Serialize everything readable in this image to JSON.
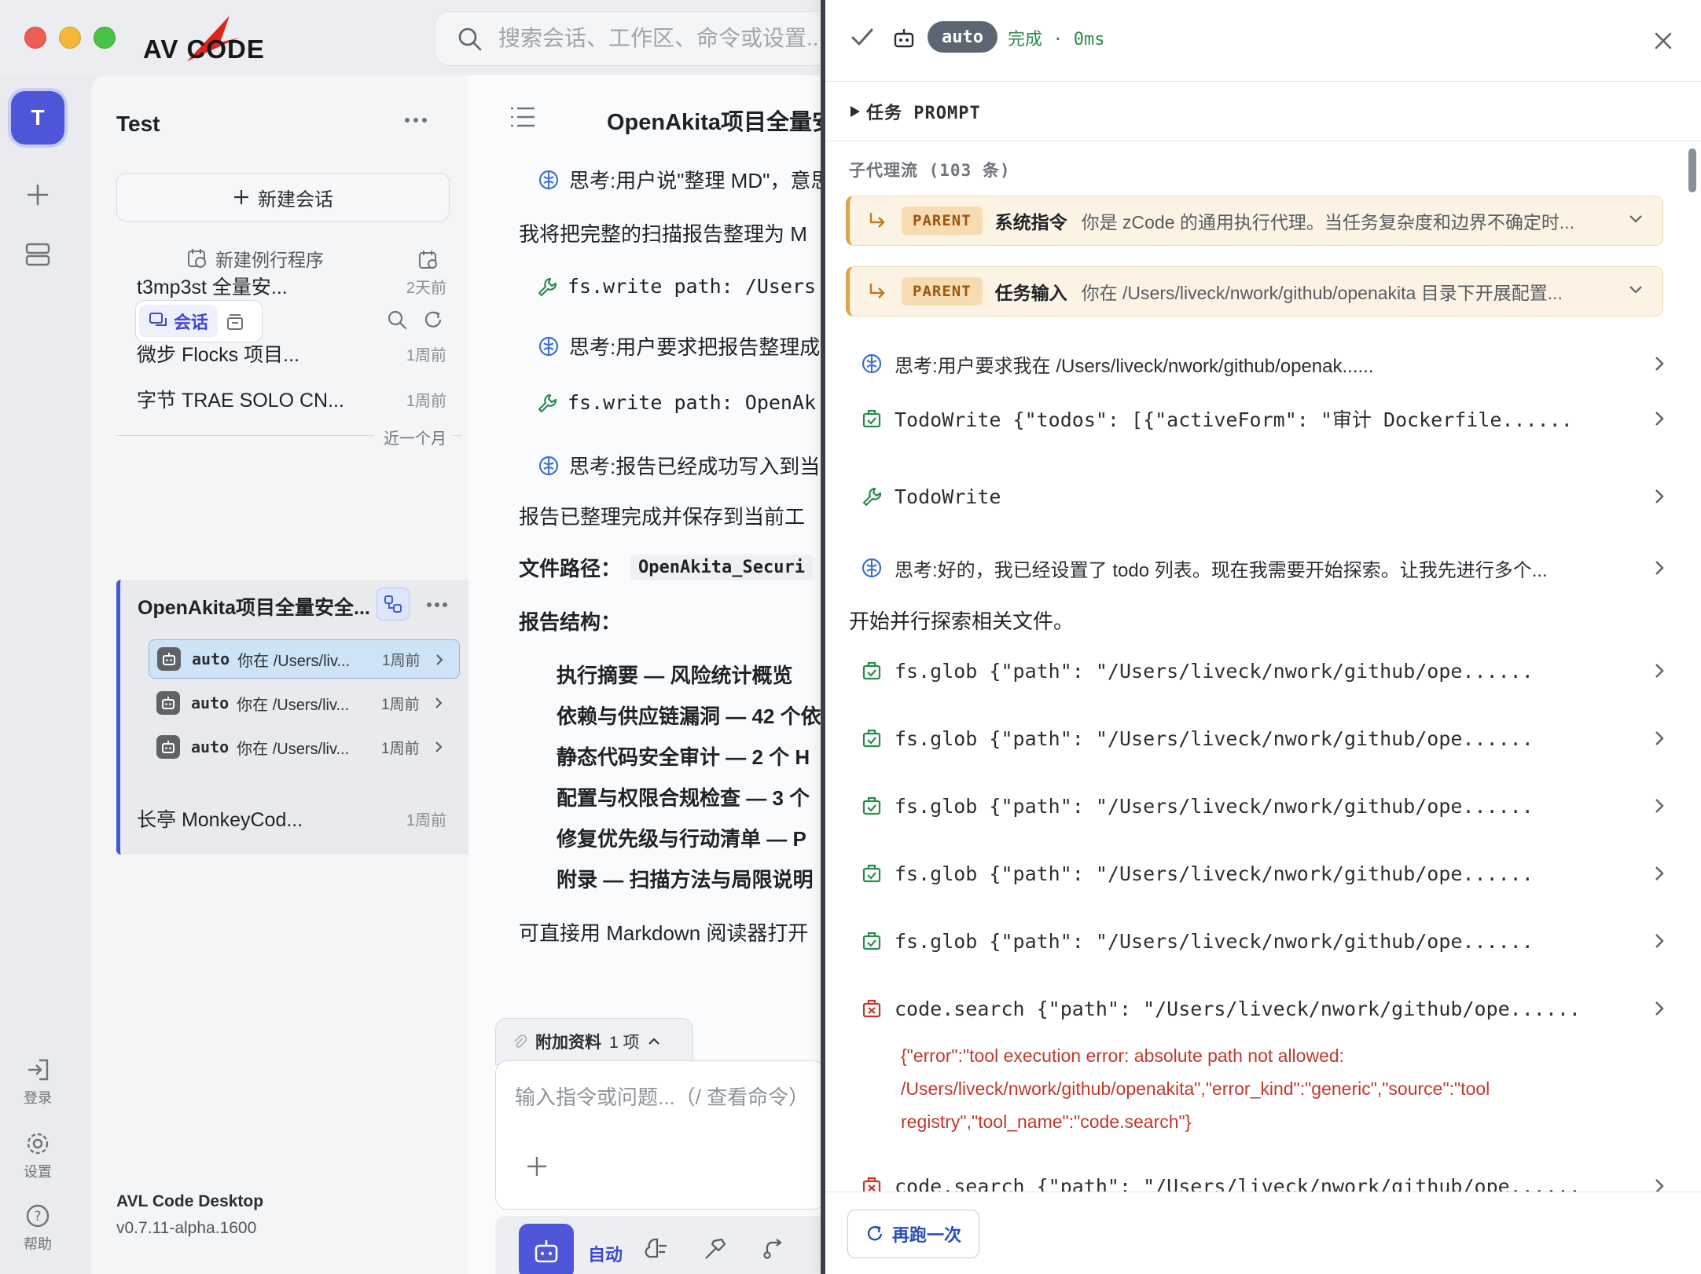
{
  "app": {
    "logo_text": "AV CODE",
    "search_placeholder": "搜索会话、工作区、命令或设置...",
    "name": "AVL Code Desktop",
    "version": "v0.7.11-alpha.1600"
  },
  "rail": {
    "avatar_letter": "T",
    "login_label": "登录",
    "settings_label": "设置",
    "help_label": "帮助"
  },
  "sidebar": {
    "workspace_title": "Test",
    "new_chat_label": "新建会话",
    "new_routine_label": "新建例行程序",
    "tab_chat_label": "会话",
    "sessions": [
      {
        "title": "t3mp3st 全量安...",
        "time": "2天前"
      },
      {
        "title": "微步 Flocks 项目...",
        "time": "1周前"
      },
      {
        "title": "字节 TRAE SOLO CN...",
        "time": "1周前"
      },
      {
        "title": "长亭 MonkeyCod...",
        "time": "1周前"
      }
    ],
    "month_divider": "近一个月",
    "active": {
      "title": "OpenAkita项目全量安全...",
      "subs": [
        {
          "who": "auto",
          "desc": "你在 /Users/liv...",
          "time": "1周前"
        },
        {
          "who": "auto",
          "desc": "你在 /Users/liv...",
          "time": "1周前"
        },
        {
          "who": "auto",
          "desc": "你在 /Users/liv...",
          "time": "1周前"
        }
      ]
    }
  },
  "main": {
    "title": "OpenAkita项目全量安全",
    "lines": [
      "思考:用户说\"整理 MD\"，意思",
      "我将把完整的扫描报告整理为 M",
      "fs.write path: /Users",
      "思考:用户要求把报告整理成",
      "fs.write path: OpenAk",
      "思考:报告已经成功写入到当前",
      "报告已整理完成并保存到当前工",
      "文件路径：",
      "OpenAkita_Securi",
      "报告结构：",
      "执行摘要 — 风险统计概览",
      "依赖与供应链漏洞 — 42 个依",
      "静态代码安全审计 — 2 个 H",
      "配置与权限合规检查 — 3 个",
      "修复优先级与行动清单 — P",
      "附录 — 扫描方法与局限说明",
      "可直接用 Markdown 阅读器打开"
    ],
    "attach_label": "附加资料",
    "attach_count": "1 项",
    "input_placeholder": "输入指令或问题...（/ 查看命令）",
    "mode_label": "自动"
  },
  "panel": {
    "agent_badge": "auto",
    "status": "完成 · 0ms",
    "prompt_label": "任务 PROMPT",
    "stream_header": "子代理流 (103 条)",
    "parents": [
      {
        "tag": "PARENT",
        "name": "系统指令",
        "text": "你是 zCode 的通用执行代理。当任务复杂度和边界不确定时..."
      },
      {
        "tag": "PARENT",
        "name": "任务输入",
        "text": "你在 /Users/liveck/nwork/github/openakita 目录下开展配置..."
      }
    ],
    "rows": [
      {
        "kind": "think",
        "text": "思考:用户要求我在 /Users/liveck/nwork/github/openak......"
      },
      {
        "kind": "tool-ok",
        "text": "TodoWrite {\"todos\": [{\"activeForm\": \"审计 Dockerfile......"
      },
      {
        "kind": "wrench",
        "text": "TodoWrite"
      },
      {
        "kind": "think",
        "text": "思考:好的，我已经设置了 todo 列表。现在我需要开始探索。让我先进行多个..."
      },
      {
        "kind": "tool-ok",
        "text": "fs.glob {\"path\": \"/Users/liveck/nwork/github/ope......"
      },
      {
        "kind": "tool-ok",
        "text": "fs.glob {\"path\": \"/Users/liveck/nwork/github/ope......"
      },
      {
        "kind": "tool-ok",
        "text": "fs.glob {\"path\": \"/Users/liveck/nwork/github/ope......"
      },
      {
        "kind": "tool-ok",
        "text": "fs.glob {\"path\": \"/Users/liveck/nwork/github/ope......"
      },
      {
        "kind": "tool-ok",
        "text": "fs.glob {\"path\": \"/Users/liveck/nwork/github/ope......"
      },
      {
        "kind": "tool-err",
        "text": "code.search {\"path\": \"/Users/liveck/nwork/github/ope......"
      },
      {
        "kind": "tool-err",
        "text": "code.search {\"path\": \"/Users/liveck/nwork/github/ope......"
      }
    ],
    "plain_text": "开始并行探索相关文件。",
    "error_text": "{\"error\":\"tool execution error: absolute path not allowed: /Users/liveck/nwork/github/openakita\",\"error_kind\":\"generic\",\"source\":\"tool registry\",\"tool_name\":\"code.search\"}",
    "rerun_label": "再跑一次"
  },
  "colors": {
    "accent": "#4f55d8",
    "success": "#2a8a4b",
    "error": "#c0392b",
    "parent_border": "#e3a245"
  }
}
